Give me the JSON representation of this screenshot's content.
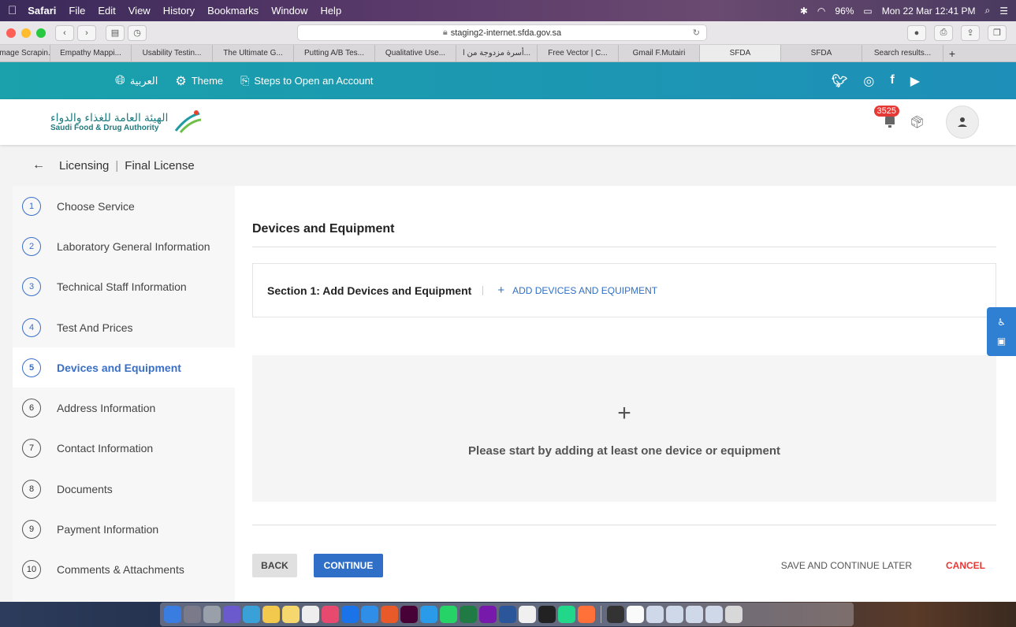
{
  "menubar": {
    "apple": "",
    "items": [
      "Safari",
      "File",
      "Edit",
      "View",
      "History",
      "Bookmarks",
      "Window",
      "Help"
    ],
    "battery": "96%",
    "datetime": "Mon 22 Mar  12:41 PM"
  },
  "browser": {
    "url": "staging2-internet.sfda.gov.sa",
    "tabs": [
      "Image Scrapin..",
      "Empathy Mappi...",
      "Usability Testin...",
      "The Ultimate G...",
      "Putting A/B Tes...",
      "Qualitative Use...",
      "أسرة مزدوجة من ا...",
      "Free Vector | C...",
      "Gmail F.Mutairi",
      "SFDA",
      "SFDA",
      "Search results..."
    ]
  },
  "topband": {
    "language": "العربية",
    "theme": "Theme",
    "steps": "Steps to Open an Account"
  },
  "header": {
    "logo_ar": "الهيئة العامة للغذاء والدواء",
    "logo_en": "Saudi Food & Drug Authority",
    "notifications": "3525"
  },
  "breadcrumb": {
    "section": "Licensing",
    "page": "Final License"
  },
  "steps": [
    {
      "num": "1",
      "label": "Choose Service"
    },
    {
      "num": "2",
      "label": "Laboratory General Information"
    },
    {
      "num": "3",
      "label": "Technical Staff Information"
    },
    {
      "num": "4",
      "label": "Test And Prices"
    },
    {
      "num": "5",
      "label": "Devices and Equipment"
    },
    {
      "num": "6",
      "label": "Address Information"
    },
    {
      "num": "7",
      "label": "Contact Information"
    },
    {
      "num": "8",
      "label": "Documents"
    },
    {
      "num": "9",
      "label": "Payment Information"
    },
    {
      "num": "10",
      "label": "Comments & Attachments"
    }
  ],
  "main": {
    "title": "Devices and Equipment",
    "section_title": "Section 1: Add Devices and Equipment",
    "add_label": "ADD DEVICES AND EQUIPMENT",
    "empty_plus": "+",
    "empty_message": "Please start by adding at least one device or equipment"
  },
  "actions": {
    "back": "BACK",
    "continue": "CONTINUE",
    "save_later": "SAVE AND CONTINUE LATER",
    "cancel": "CANCEL"
  },
  "colors": {
    "primary": "#2f6fc7",
    "teal": "#1aa1ab",
    "danger": "#e53935"
  }
}
